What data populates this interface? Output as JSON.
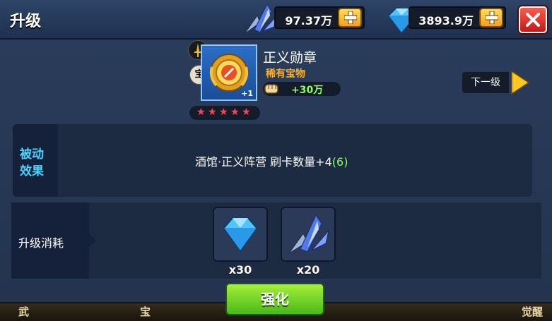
{
  "header": {
    "title": "升级",
    "crystal_amount": "97.37万",
    "diamond_amount": "3893.9万"
  },
  "item": {
    "name": "正义勋章",
    "rarity": "稀有宝物",
    "level_badge": "+1",
    "type_badge": "宝",
    "power": "+30万",
    "stars": 5
  },
  "next_level_label": "下一级",
  "passive": {
    "label_line1": "被动",
    "label_line2": "效果",
    "text": "酒馆·正义阵营 刷卡数量+4",
    "highlight": "(6)"
  },
  "cost": {
    "label": "升级消耗",
    "items": [
      {
        "icon": "diamond-icon",
        "qty": "x30"
      },
      {
        "icon": "crystal-icon",
        "qty": "x20"
      }
    ]
  },
  "enhance_label": "强化",
  "background_tabs": [
    "武",
    "宝",
    "觉醒"
  ],
  "colors": {
    "rarity": "#ffb020",
    "highlight": "#8aff5a",
    "passive_label": "#4ad4ff",
    "enhance_button": "#6cd42a"
  }
}
